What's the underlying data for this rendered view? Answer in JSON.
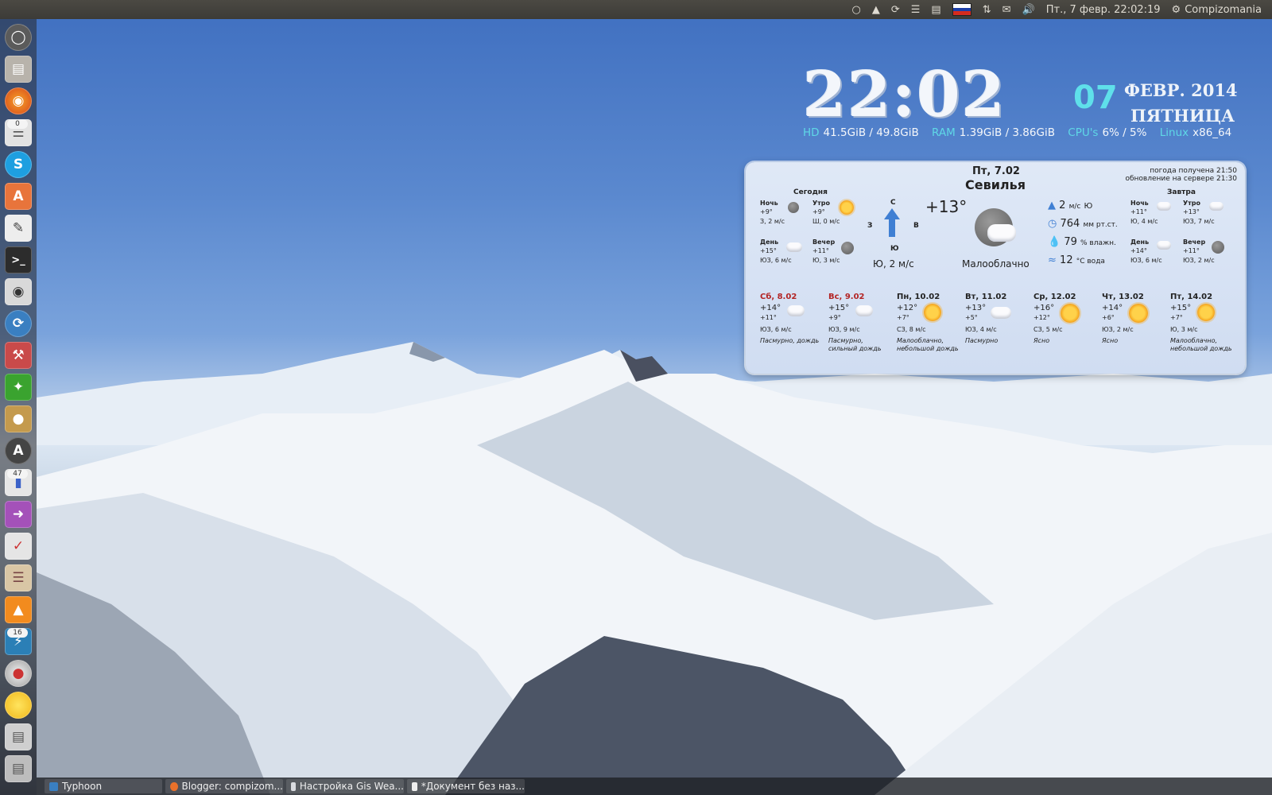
{
  "top_panel": {
    "datetime": "Пт., 7 февр. 22:02:19",
    "user": "Compizomania",
    "flag_colors": [
      "#ffffff",
      "#1c3fa8",
      "#d52b1e"
    ]
  },
  "launcher": {
    "badges": [
      "0",
      "47",
      "16"
    ]
  },
  "clock": {
    "time": "22:02",
    "day": "07",
    "month_year": "ФЕВР. 2014",
    "weekday": "ПЯТНИЦА"
  },
  "system": {
    "hd_label": "HD",
    "hd_value": "41.5GiB / 49.8GiB",
    "ram_label": "RAM",
    "ram_value": "1.39GiB / 3.86GiB",
    "cpu_label": "CPU's",
    "cpu_value": "6% / 5%",
    "os_label": "Linux",
    "os_value": "x86_64"
  },
  "weather": {
    "date": "Пт, 7.02",
    "city": "Севилья",
    "received": "погода получена 21:50",
    "server_update": "обновление на сервере 21:30",
    "today_label": "Сегодня",
    "tomorrow_label": "Завтра",
    "compass": {
      "n": "С",
      "s": "Ю",
      "w": "З",
      "e": "В"
    },
    "wind_now": "Ю, 2 м/с",
    "temp_now": "+13°",
    "condition_now": "Малооблачно",
    "details": {
      "wind_value": "2",
      "wind_unit": "м/с",
      "wind_dir": "Ю",
      "pressure_value": "764",
      "pressure_unit": "мм рт.ст.",
      "humidity_value": "79",
      "humidity_unit": "% влажн.",
      "water_value": "12",
      "water_unit": "°С вода"
    },
    "today": [
      {
        "label": "Ночь",
        "temp": "+9°",
        "wind": "З, 2 м/с"
      },
      {
        "label": "Утро",
        "temp": "+9°",
        "wind": "Ш, 0 м/с"
      },
      {
        "label": "День",
        "temp": "+15°",
        "wind": "ЮЗ, 6 м/с"
      },
      {
        "label": "Вечер",
        "temp": "+11°",
        "wind": "Ю, 3 м/с"
      }
    ],
    "tomorrow": [
      {
        "label": "Ночь",
        "temp": "+11°",
        "wind": "Ю, 4 м/с"
      },
      {
        "label": "Утро",
        "temp": "+13°",
        "wind": "ЮЗ, 7 м/с"
      },
      {
        "label": "День",
        "temp": "+14°",
        "wind": "ЮЗ, 6 м/с"
      },
      {
        "label": "Вечер",
        "temp": "+11°",
        "wind": "ЮЗ, 2 м/с"
      }
    ],
    "forecast": [
      {
        "day": "Сб, 8.02",
        "weekend": true,
        "high": "+14°",
        "low": "+11°",
        "wind": "ЮЗ, 6 м/с",
        "desc1": "Пасмурно, дождь",
        "desc2": "",
        "icon": "rain-icon"
      },
      {
        "day": "Вс, 9.02",
        "weekend": true,
        "high": "+15°",
        "low": "+9°",
        "wind": "ЮЗ, 9 м/с",
        "desc1": "Пасмурно,",
        "desc2": "сильный дождь",
        "icon": "heavy-rain-icon"
      },
      {
        "day": "Пн, 10.02",
        "weekend": false,
        "high": "+12°",
        "low": "+7°",
        "wind": "СЗ, 8 м/с",
        "desc1": "Малооблачно,",
        "desc2": "небольшой дождь",
        "icon": "sun-rain-icon"
      },
      {
        "day": "Вт, 11.02",
        "weekend": false,
        "high": "+13°",
        "low": "+5°",
        "wind": "ЮЗ, 4 м/с",
        "desc1": "Пасмурно",
        "desc2": "",
        "icon": "cloud-icon"
      },
      {
        "day": "Ср, 12.02",
        "weekend": false,
        "high": "+16°",
        "low": "+12°",
        "wind": "СЗ, 5 м/с",
        "desc1": "Ясно",
        "desc2": "",
        "icon": "sun-icon"
      },
      {
        "day": "Чт, 13.02",
        "weekend": false,
        "high": "+14°",
        "low": "+6°",
        "wind": "ЮЗ, 2 м/с",
        "desc1": "Ясно",
        "desc2": "",
        "icon": "sun-icon"
      },
      {
        "day": "Пт, 14.02",
        "weekend": false,
        "high": "+15°",
        "low": "+7°",
        "wind": "Ю, 3 м/с",
        "desc1": "Малооблачно,",
        "desc2": "небольшой дождь",
        "icon": "sun-rain-icon"
      }
    ]
  },
  "taskbar": [
    {
      "label": "Typhoon",
      "icon": "typhoon-icon"
    },
    {
      "label": "Blogger: compizom...",
      "icon": "firefox-icon"
    },
    {
      "label": "Настройка Gis Wea...",
      "icon": "window-icon"
    },
    {
      "label": "*Документ без наз...",
      "icon": "document-icon"
    }
  ]
}
